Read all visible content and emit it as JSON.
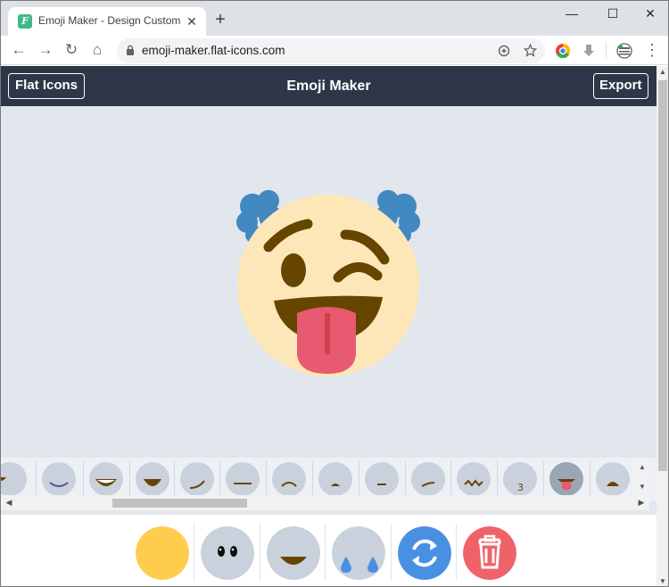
{
  "browser": {
    "tab": {
      "title": "Emoji Maker - Design Custom E",
      "favicon_letter": "F",
      "close_glyph": "✕"
    },
    "new_tab_glyph": "+",
    "window_controls": {
      "minimize": "—",
      "maximize": "☐",
      "close": "✕"
    },
    "nav": {
      "back": "←",
      "forward": "→",
      "reload": "↻",
      "home": "⌂"
    },
    "address": "emoji-maker.flat-icons.com",
    "menu_glyph": "⋮"
  },
  "app": {
    "brand_label": "Flat Icons",
    "title": "Emoji Maker",
    "export_label": "Export"
  },
  "emoji": {
    "face_color": "#fde7b8",
    "hair_color": "#4289c1",
    "feature_color": "#664500",
    "tongue_color": "#e75a70",
    "tongue_line_color": "#d13f4f"
  },
  "parts_strip": {
    "items": [
      "mouth-partial",
      "mouth-smile-purple",
      "mouth-grin-teeth",
      "mouth-open-smile",
      "mouth-smirk",
      "mouth-flat",
      "mouth-frown",
      "mouth-small-frown",
      "mouth-small-flat",
      "mouth-slant",
      "mouth-wavy",
      "mouth-kiss",
      "mouth-tongue-selected",
      "mouth-open-frown"
    ],
    "selected_index": 12,
    "part_color": "#c8d1dc"
  },
  "tools": {
    "items": [
      {
        "name": "face-color-tool",
        "color": "#ffcc4d"
      },
      {
        "name": "eyes-tool",
        "color": "#c8d1dc"
      },
      {
        "name": "mouth-tool",
        "color": "#c8d1dc"
      },
      {
        "name": "extras-tool",
        "color": "#c8d1dc"
      },
      {
        "name": "randomize-tool",
        "color": "#4a90e2"
      },
      {
        "name": "delete-tool",
        "color": "#f0626a"
      }
    ]
  }
}
